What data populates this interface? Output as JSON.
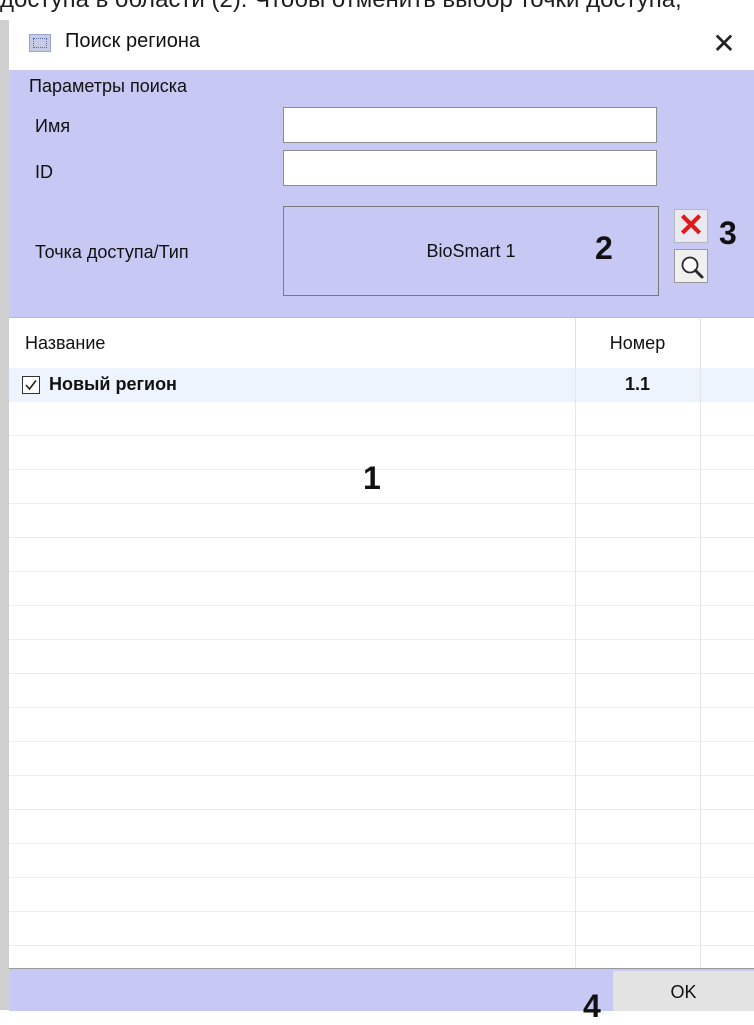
{
  "doc_text": "доступа в области (2). Чтобы отменить выбор точки доступа,",
  "window": {
    "title": "Поиск региона",
    "close_symbol": "✕"
  },
  "search": {
    "group_label": "Параметры поиска",
    "name_label": "Имя",
    "name_value": "",
    "id_label": "ID",
    "id_value": "",
    "access_point_label": "Точка доступа/Тип",
    "access_point_value": "BioSmart 1",
    "clear_symbol": "✕"
  },
  "callouts": {
    "c1": "1",
    "c2": "2",
    "c3": "3",
    "c4": "4"
  },
  "table": {
    "columns": [
      "Название",
      "Номер"
    ],
    "rows": [
      {
        "checked": true,
        "name": "Новый регион",
        "number": "1.1"
      }
    ]
  },
  "footer": {
    "ok_label": "OK"
  },
  "colors": {
    "panel": "#c8c8f4",
    "clear_icon": "#e0191b",
    "row_highlight": "#eef4fd"
  },
  "icons": {
    "app": "region-window-icon",
    "clear": "red-x-icon",
    "find": "magnifier-icon",
    "check": "checkmark-icon"
  }
}
